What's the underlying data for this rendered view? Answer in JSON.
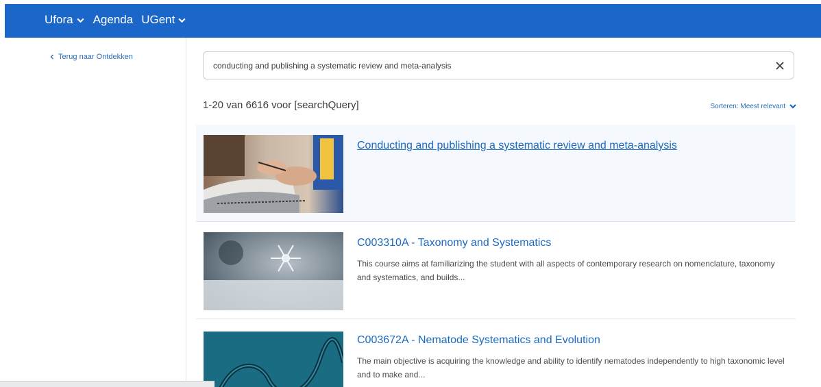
{
  "nav": {
    "items": [
      {
        "label": "Ufora",
        "has_dropdown": true
      },
      {
        "label": "Agenda",
        "has_dropdown": false
      },
      {
        "label": "UGent",
        "has_dropdown": true
      }
    ]
  },
  "sidebar": {
    "back_label": "Terug naar Ontdekken"
  },
  "search": {
    "value": "conducting and publishing a systematic review and meta-analysis",
    "clear_icon": "close-icon"
  },
  "results_header": {
    "count_text": "1-20 van 6616 voor [searchQuery]",
    "sort_label": "Sorteren: Meest relevant"
  },
  "results": [
    {
      "title": "Conducting and publishing a systematic review and meta-analysis",
      "description": "",
      "thumbnail": "hands-writing-notebook-image"
    },
    {
      "title": "C003310A - Taxonomy and Systematics",
      "description": "This course aims at familiarizing the student with all aspects of contemporary research on nomenclature, taxonomy and systematics, and builds...",
      "thumbnail": "snowflake-image"
    },
    {
      "title": "C003672A - Nematode Systematics and Evolution",
      "description": "The main objective is acquiring the knowledge and ability to identify nematodes independently to high taxonomic level and to make and...",
      "thumbnail": "nematode-image"
    }
  ],
  "colors": {
    "navbar": "#1b66c9",
    "link": "#1b6ac2",
    "highlight_row": "#f5f8fc"
  }
}
